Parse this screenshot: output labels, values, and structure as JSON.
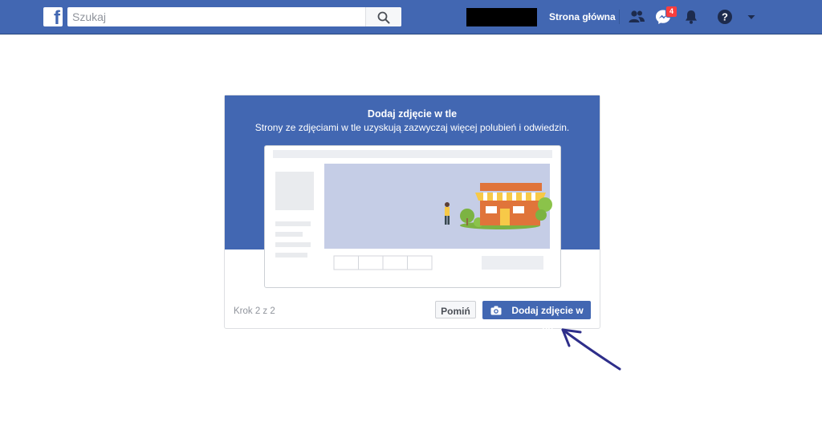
{
  "topbar": {
    "logo_letter": "f",
    "search": {
      "placeholder": "Szukaj",
      "value": ""
    },
    "home_label": "Strona główna",
    "messenger_badge": "4",
    "icons": [
      "friends-icon",
      "messenger-icon",
      "notifications-icon",
      "help-icon",
      "menu-caret-icon"
    ]
  },
  "dialog": {
    "title": "Dodaj zdjęcie w tle",
    "subtitle": "Strony ze zdjęciami w tle uzyskują zazwyczaj więcej polubień i odwiedzin.",
    "step_text": "Krok 2 z 2",
    "skip_label": "Pomiń",
    "add_photo_label": "Dodaj zdjęcie w tle"
  },
  "colors": {
    "brand": "#4267b2",
    "cover_bg": "#c5cde6",
    "shop_wall": "#e0743a",
    "awning": "#f7c948",
    "tree": "#7cb342",
    "annotation": "#2e2e8a"
  }
}
